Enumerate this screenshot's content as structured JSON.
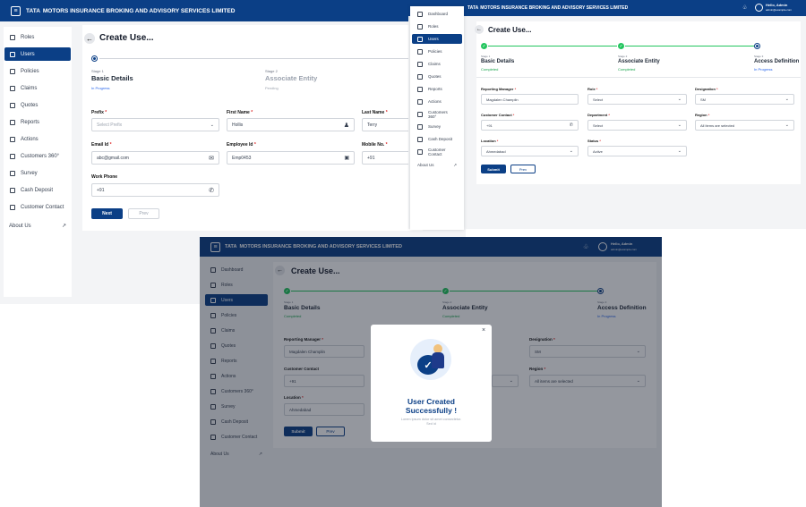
{
  "brand": {
    "bold": "TATA",
    "rest": "MOTORS INSURANCE BROKING AND ADVISORY SERVICES LIMITED"
  },
  "user": {
    "name": "Hello, Admin",
    "email": "admin@example.com"
  },
  "page_title": "Create Use...",
  "sidebar1": {
    "items": [
      "Roles",
      "Users",
      "Policies",
      "Claims",
      "Quotes",
      "Reports",
      "Actions",
      "Customers 360°",
      "Survey",
      "Cash Deposit",
      "Customer Contact"
    ],
    "about": "About Us"
  },
  "sidebar2": {
    "items": [
      "Dashboard",
      "Roles",
      "Users",
      "Policies",
      "Claims",
      "Quotes",
      "Reports",
      "Actions",
      "Customers 360°",
      "Survey",
      "Cash Deposit",
      "Customer Contact"
    ],
    "about": "About Us"
  },
  "steps": [
    {
      "label": "Stage 1",
      "name": "Basic Details"
    },
    {
      "label": "Stage 2",
      "name": "Associate Entity"
    },
    {
      "label": "Stage 3",
      "name": "Access Definition"
    }
  ],
  "status": {
    "in_progress": "In Progress",
    "pending": "Pending",
    "completed": "Completed"
  },
  "form1": {
    "prefix_label": "Prefix",
    "prefix_ph": "Select Prefix",
    "first_label": "First Name",
    "first_val": "Hollis",
    "last_label": "Last Name",
    "last_val": "Terry",
    "email_label": "Email Id",
    "email_val": "abc@gmail.com",
    "emp_label": "Employee Id",
    "emp_val": "Emp0453",
    "mobile_label": "Mobile No.",
    "mobile_val": "+91",
    "work_label": "Work Phone",
    "work_val": "+91",
    "next": "Next",
    "prev": "Prev"
  },
  "form3": {
    "rm_label": "Reporting Manager",
    "rm_val": "Magdalen Champlin",
    "role_label": "Role",
    "role_val": "Select",
    "desig_label": "Designation",
    "desig_val": "SM",
    "cc_label": "Customer Contact",
    "cc_val": "+91",
    "dept_label": "Department",
    "dept_val": "Select",
    "region_label": "Region",
    "region_val": "All items are selected",
    "loc_label": "Location",
    "loc_val": "Ahmedabad",
    "status_label": "Status",
    "status_val": "Active",
    "submit": "Submit",
    "prev": "Prev"
  },
  "modal": {
    "title": "User Created Successfully !",
    "sub": "Lorem ipsum dolor sit amet consectetur. Sed id"
  }
}
